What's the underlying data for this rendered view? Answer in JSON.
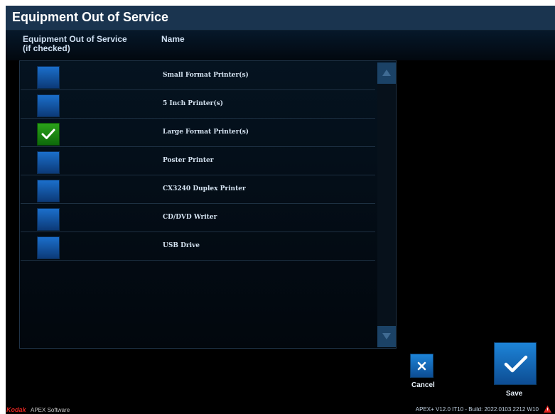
{
  "window": {
    "title": "Equipment Out of Service"
  },
  "table": {
    "col_checked_line1": "Equipment Out of Service",
    "col_checked_line2": "(if checked)",
    "col_name": "Name",
    "rows": [
      {
        "label": "Small Format Printer(s)",
        "checked": false
      },
      {
        "label": "5 Inch Printer(s)",
        "checked": false
      },
      {
        "label": "Large Format Printer(s)",
        "checked": true
      },
      {
        "label": "Poster Printer",
        "checked": false
      },
      {
        "label": "CX3240 Duplex Printer",
        "checked": false
      },
      {
        "label": "CD/DVD Writer",
        "checked": false
      },
      {
        "label": "USB Drive",
        "checked": false
      }
    ]
  },
  "buttons": {
    "cancel": "Cancel",
    "save": "Save"
  },
  "footer": {
    "brand": "Kodak",
    "product": "APEX Software",
    "build": "APEX+ V12.0 IT10 - Build: 2022.0103.2212  W10"
  },
  "colors": {
    "accent_blue": "#1d84d8",
    "checked_green": "#2aa21a",
    "title_bar": "#1a344f"
  },
  "icons": {
    "checkmark": "checkmark-icon",
    "close": "close-icon",
    "scroll_up": "scroll-up-icon",
    "scroll_down": "scroll-down-icon",
    "warning": "warning-icon"
  }
}
